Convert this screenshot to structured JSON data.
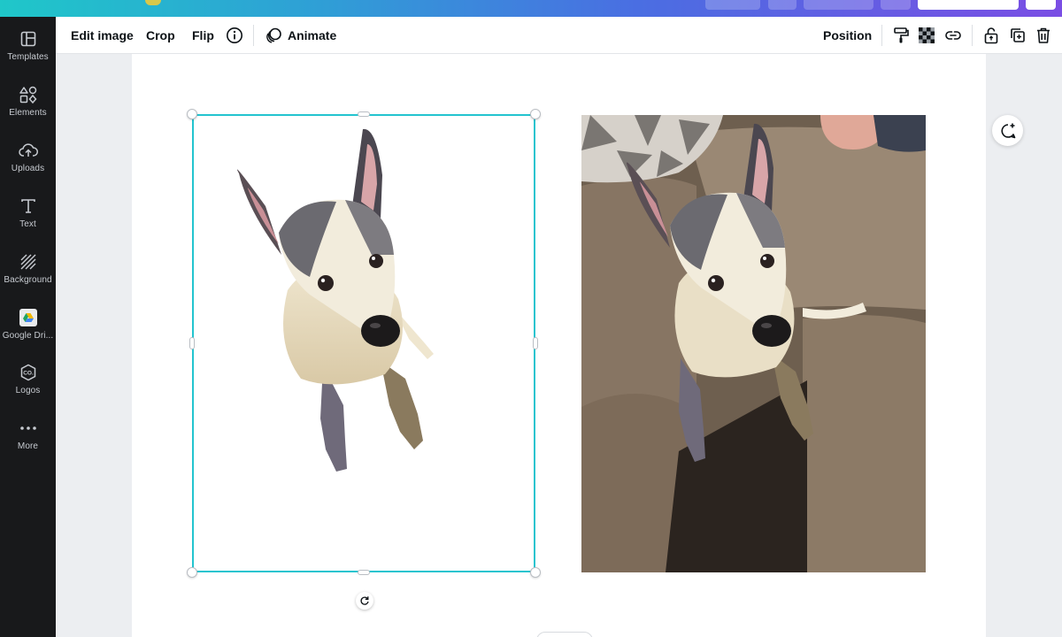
{
  "rail": {
    "items": [
      {
        "label": "Templates",
        "icon": "templates-icon"
      },
      {
        "label": "Elements",
        "icon": "elements-icon"
      },
      {
        "label": "Uploads",
        "icon": "uploads-icon"
      },
      {
        "label": "Text",
        "icon": "text-icon"
      },
      {
        "label": "Background",
        "icon": "background-icon"
      },
      {
        "label": "Google Dri...",
        "icon": "google-drive-icon"
      },
      {
        "label": "Logos",
        "icon": "logos-icon"
      },
      {
        "label": "More",
        "icon": "more-icon"
      }
    ]
  },
  "toolbar": {
    "edit_image": "Edit image",
    "crop": "Crop",
    "flip": "Flip",
    "animate": "Animate",
    "position": "Position"
  },
  "colors": {
    "accent": "#23c4cf",
    "rail_bg": "#18191b",
    "workspace_bg": "#eceef1"
  }
}
